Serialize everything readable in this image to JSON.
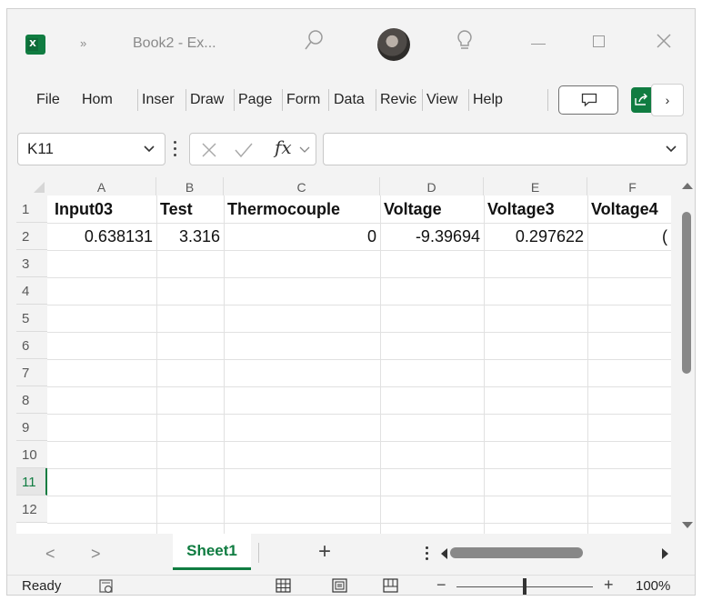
{
  "window": {
    "title": "Book2 - Ex...",
    "overflow_chevron": "»"
  },
  "menu": {
    "items": [
      "File",
      "Hom",
      "Inser",
      "Draw",
      "Page",
      "Form",
      "Data",
      "Reviє",
      "View",
      "Help"
    ],
    "more_label": "›"
  },
  "formula_bar": {
    "name_box": "K11",
    "formula": ""
  },
  "grid": {
    "columns": [
      "A",
      "B",
      "C",
      "D",
      "E",
      "F"
    ],
    "rows": [
      "1",
      "2",
      "3",
      "4",
      "5",
      "6",
      "7",
      "8",
      "9",
      "10",
      "11",
      "12"
    ],
    "active_row": "11",
    "header_row": [
      "Input03",
      "Test",
      "Thermocouple",
      "Voltage",
      "Voltage3",
      "Voltage4"
    ],
    "data_row": [
      "0.638131",
      "3.316",
      "0",
      "-9.39694",
      "0.297622",
      "("
    ]
  },
  "sheets": {
    "tabs": [
      "Sheet1"
    ],
    "active": "Sheet1",
    "nav_prev": "<",
    "nav_next": ">",
    "add_label": "+"
  },
  "status": {
    "mode": "Ready",
    "zoom_minus": "−",
    "zoom_plus": "+",
    "zoom": "100%",
    "zoom_level_fraction": 0.5
  },
  "icons": {
    "app": "excel-logo-icon",
    "search": "search-icon",
    "idea": "lightbulb-icon",
    "comment": "comment-icon",
    "share": "share-icon"
  },
  "colors": {
    "accent": "#107c41",
    "chrome": "#f3f3f3"
  }
}
